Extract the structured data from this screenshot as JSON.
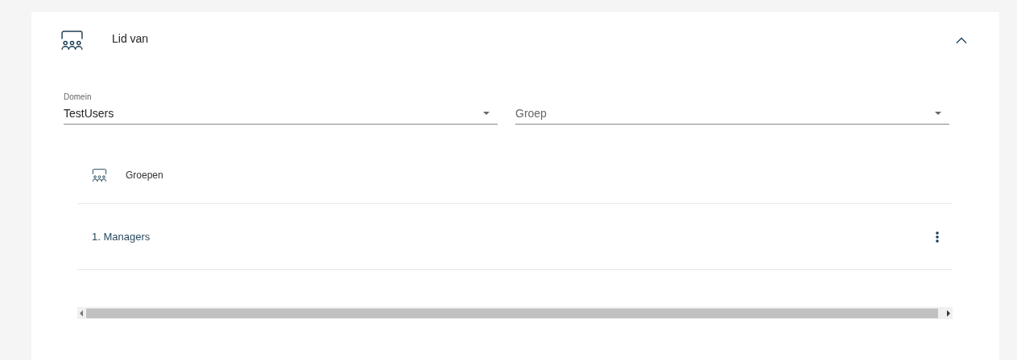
{
  "section": {
    "title": "Lid van",
    "expanded": true
  },
  "filters": [
    {
      "label": "Domein",
      "value": "TestUsers"
    },
    {
      "placeholder": "Groep"
    }
  ],
  "table": {
    "heading": "Groepen",
    "rows": [
      {
        "label": "1. Managers"
      }
    ]
  }
}
